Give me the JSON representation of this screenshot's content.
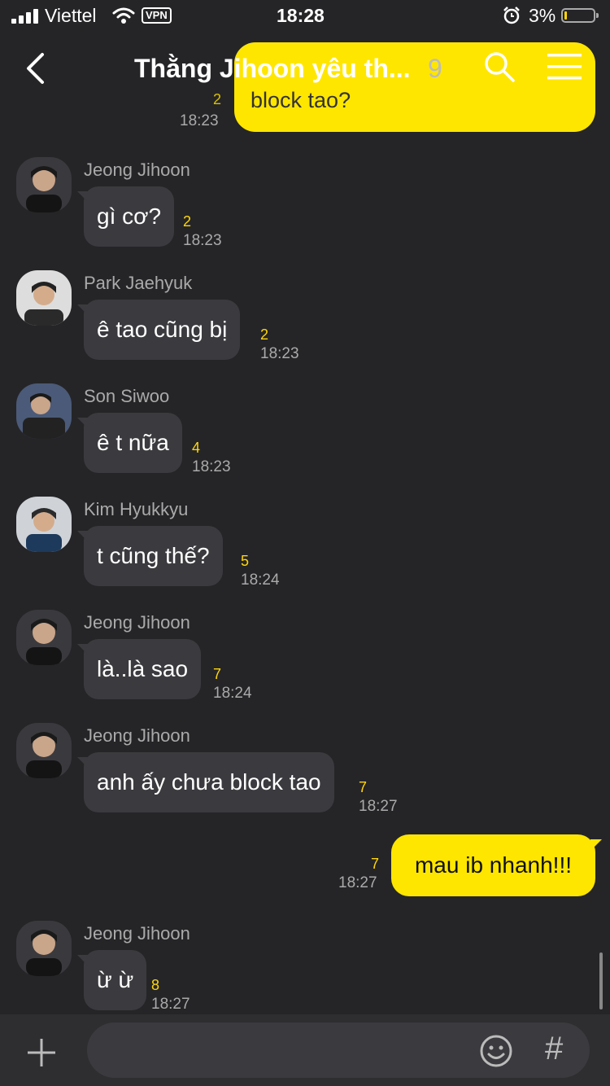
{
  "status": {
    "carrier": "Viettel",
    "vpn": "VPN",
    "time": "18:28",
    "battery": "3%",
    "battery_level": 0.03
  },
  "header": {
    "title": "Thằng Jihoon yêu th...",
    "count": "9"
  },
  "peek": {
    "text": "block tao?",
    "num": "2",
    "time": "18:23"
  },
  "messages": [
    {
      "sender": "Jeong Jihoon",
      "text": "gì cơ?",
      "num": "2",
      "time": "18:23"
    },
    {
      "sender": "Park Jaehyuk",
      "text": "ê tao cũng bị",
      "num": "2",
      "time": "18:23"
    },
    {
      "sender": "Son Siwoo",
      "text": "ê t nữa",
      "num": "4",
      "time": "18:23"
    },
    {
      "sender": "Kim Hyukkyu",
      "text": "t cũng thế?",
      "num": "5",
      "time": "18:24"
    },
    {
      "sender": "Jeong Jihoon",
      "text": "là..là sao",
      "num": "7",
      "time": "18:24"
    },
    {
      "sender": "Jeong Jihoon",
      "text": "anh ấy chưa block tao",
      "num": "7",
      "time": "18:27"
    },
    {
      "sender": "Jeong Jihoon",
      "text": "ừ ừ",
      "num": "8",
      "time": "18:27"
    }
  ],
  "my_message": {
    "text": "mau ib nhanh!!!",
    "num": "7",
    "time": "18:27"
  },
  "input": {
    "placeholder": "",
    "hash": "#"
  },
  "colors": {
    "accent": "#ffe600",
    "background": "#252528",
    "bubble": "#3b3b3f",
    "unread": "#ffd60a"
  }
}
